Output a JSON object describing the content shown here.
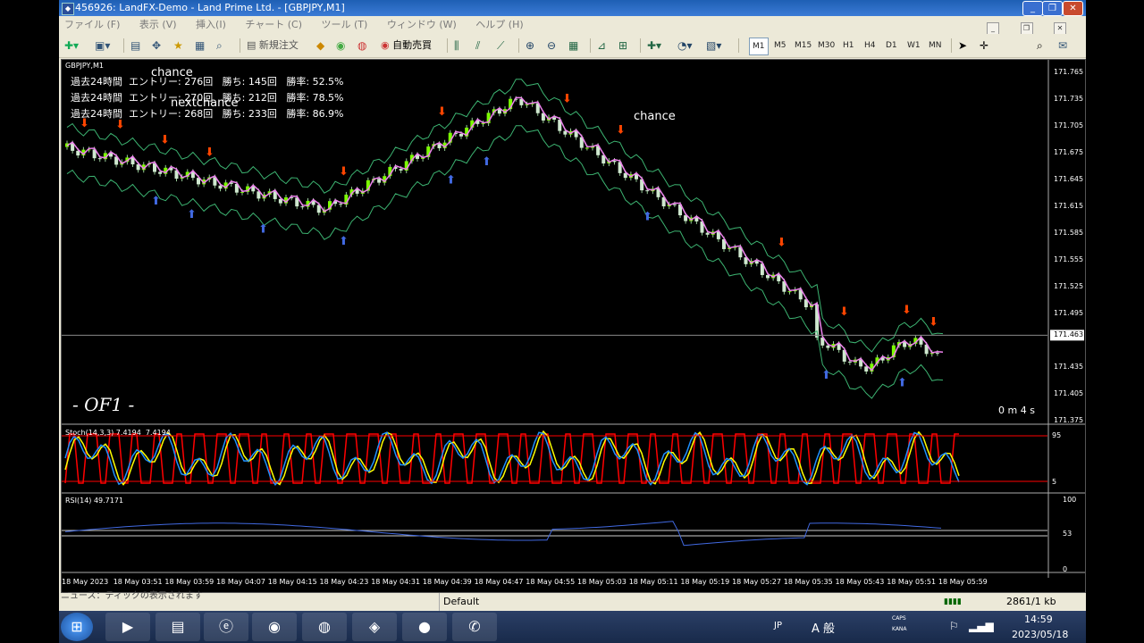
{
  "window": {
    "title": "456926: LandFX-Demo - Land Prime Ltd. - [GBPJPY,M1]",
    "buttons": [
      "_",
      "❐",
      "✕"
    ]
  },
  "menubar": {
    "items": [
      "ファイル (F)",
      "表示 (V)",
      "挿入(I)",
      "チャート (C)",
      "ツール (T)",
      "ウィンドウ (W)",
      "ヘルプ (H)"
    ]
  },
  "toolbar": {
    "new_order": "新規注文",
    "auto_trade": "自動売買",
    "timeframes": [
      "M1",
      "M5",
      "M15",
      "M30",
      "H1",
      "H4",
      "D1",
      "W1",
      "MN"
    ],
    "active_timeframe": "M1"
  },
  "chart": {
    "symbol_label": "GBPJPY,M1",
    "stats": [
      "過去24時間  エントリー: 276回   勝ち: 145回   勝率: 52.5%",
      "過去24時間  エントリー: 270回   勝ち: 212回   勝率: 78.5%",
      "過去24時間  エントリー: 268回   勝ち: 233回   勝率: 86.9%"
    ],
    "annotations": {
      "chance_1": "chance",
      "next_chance": "nextchance",
      "chance_2": "chance"
    },
    "watermark": "- OF1 -",
    "timer": "0 m 4 s",
    "current_price": "171.463",
    "price_ticks": [
      "171.765",
      "171.735",
      "171.705",
      "171.675",
      "171.645",
      "171.615",
      "171.585",
      "171.555",
      "171.525",
      "171.495",
      "171.463",
      "171.435",
      "171.405",
      "171.375"
    ],
    "time_ticks": [
      "18 May 2023",
      "18 May 03:51",
      "18 May 03:59",
      "18 May 04:07",
      "18 May 04:15",
      "18 May 04:23",
      "18 May 04:31",
      "18 May 04:39",
      "18 May 04:47",
      "18 May 04:55",
      "18 May 05:03",
      "18 May 05:11",
      "18 May 05:19",
      "18 May 05:27",
      "18 May 05:35",
      "18 May 05:43",
      "18 May 05:51",
      "18 May 05:59"
    ],
    "stoch_label": "Stoch(14,3,3) 7.4194  7.4194",
    "stoch_ticks": [
      "95",
      "5"
    ],
    "rsi_label": "RSI(14) 49.7171",
    "rsi_ticks": [
      "100",
      "53",
      "0"
    ],
    "colors": {
      "bull": "#7CFC00",
      "bear": "#cfe8cf",
      "band": "#3cb371",
      "ma": "#ee82ee",
      "sell_arrow": "#ff4500",
      "buy_arrow": "#4169e1",
      "stoch_main": "#1e90ff",
      "stoch_signal": "#ffff00",
      "stoch_alt": "#ff0000",
      "rsi": "#4169e1"
    }
  },
  "statusbar": {
    "left": "ニュース：ティックの表示されます",
    "profile": "Default",
    "traffic": "2861/1 kb"
  },
  "taskbar": {
    "apps": [
      "explorer-icon",
      "media-icon",
      "folder-icon",
      "ie-icon",
      "edge-icon",
      "chrome-icon",
      "mt4-icon",
      "rec-icon",
      "line-icon"
    ],
    "ime": "JP",
    "ime_mode": "A 般",
    "time": "14:59",
    "date": "2023/05/18",
    "caps": "CAPS",
    "kana": "KANA"
  }
}
